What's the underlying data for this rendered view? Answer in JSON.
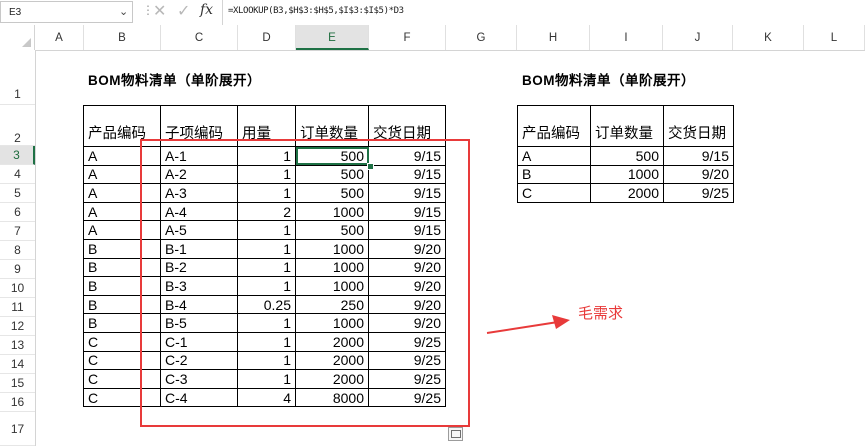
{
  "formula_bar": {
    "name_box": "E3",
    "caret": "⌄",
    "separator": "⋮",
    "cancel_icon": "✕",
    "enter_icon": "✓",
    "fx_icon": "fx",
    "formula": "=XLOOKUP(B3,$H$3:$H$5,$I$3:$I$5)*D3"
  },
  "columns": [
    "A",
    "B",
    "C",
    "D",
    "E",
    "F",
    "G",
    "H",
    "I",
    "J",
    "K",
    "L"
  ],
  "selected_column": "E",
  "rows": [
    "1",
    "2",
    "3",
    "4",
    "5",
    "6",
    "7",
    "8",
    "9",
    "10",
    "11",
    "12",
    "13",
    "14",
    "15",
    "16",
    "17"
  ],
  "selected_row": "3",
  "bom": {
    "title": "BOM物料清单（单阶展开）",
    "headers": [
      "产品编码",
      "子项编码",
      "用量",
      "订单数量",
      "交货日期"
    ],
    "rows": [
      [
        "A",
        "A-1",
        "1",
        "500",
        "9/15"
      ],
      [
        "A",
        "A-2",
        "1",
        "500",
        "9/15"
      ],
      [
        "A",
        "A-3",
        "1",
        "500",
        "9/15"
      ],
      [
        "A",
        "A-4",
        "2",
        "1000",
        "9/15"
      ],
      [
        "A",
        "A-5",
        "1",
        "500",
        "9/15"
      ],
      [
        "B",
        "B-1",
        "1",
        "1000",
        "9/20"
      ],
      [
        "B",
        "B-2",
        "1",
        "1000",
        "9/20"
      ],
      [
        "B",
        "B-3",
        "1",
        "1000",
        "9/20"
      ],
      [
        "B",
        "B-4",
        "0.25",
        "250",
        "9/20"
      ],
      [
        "B",
        "B-5",
        "1",
        "1000",
        "9/20"
      ],
      [
        "C",
        "C-1",
        "1",
        "2000",
        "9/25"
      ],
      [
        "C",
        "C-2",
        "1",
        "2000",
        "9/25"
      ],
      [
        "C",
        "C-3",
        "1",
        "2000",
        "9/25"
      ],
      [
        "C",
        "C-4",
        "4",
        "8000",
        "9/25"
      ]
    ]
  },
  "orders": {
    "title": "BOM物料清单（单阶展开）",
    "headers": [
      "产品编码",
      "订单数量",
      "交货日期"
    ],
    "rows": [
      [
        "A",
        "500",
        "9/15"
      ],
      [
        "B",
        "1000",
        "9/20"
      ],
      [
        "C",
        "2000",
        "9/25"
      ]
    ]
  },
  "annotation": {
    "label": "毛需求",
    "color": "#e83a3a"
  },
  "colors": {
    "selection": "#1e7145",
    "highlight_box": "#e83a3a"
  }
}
